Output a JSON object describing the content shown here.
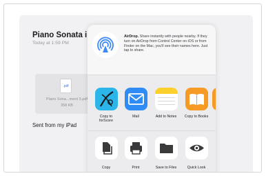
{
  "mail": {
    "title": "Piano Sonata in C",
    "date": "Today at 1:59 PM",
    "attachment": {
      "ext": ".pdf",
      "name": "Piano Sona...ment 3.pdf",
      "size": "358 KB"
    },
    "signature": "Sent from my iPad"
  },
  "share_sheet": {
    "airdrop": {
      "heading": "AirDrop.",
      "text": " Share instantly with people nearby. If they turn on AirDrop from Control Center on iOS or from Finder on the Mac, you'll see their names here. Just tap to share."
    },
    "apps": [
      {
        "label": "Copy to\nforScore",
        "icon": "forscore-icon",
        "color": "#2bb5e8"
      },
      {
        "label": "Mail",
        "icon": "mail-icon",
        "color": "#2f8cf5"
      },
      {
        "label": "Add to Notes",
        "icon": "notes-icon",
        "color": "#fbd02c"
      },
      {
        "label": "Copy to Books",
        "icon": "books-icon",
        "color": "#f59a24"
      }
    ],
    "actions": [
      {
        "label": "Copy",
        "icon": "copy-icon"
      },
      {
        "label": "Print",
        "icon": "print-icon"
      },
      {
        "label": "Save to Files",
        "icon": "folder-icon"
      },
      {
        "label": "Quick Look",
        "icon": "eye-icon"
      }
    ]
  }
}
